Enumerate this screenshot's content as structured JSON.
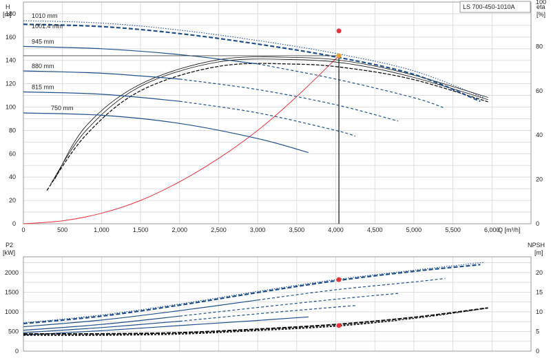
{
  "chart_data": [
    {
      "type": "line",
      "title": "LS 700-450-1010A",
      "x_unit": "Q [m³/h]",
      "xlim": [
        0,
        6500
      ],
      "x_ticks": [
        "0",
        "500",
        "1,000",
        "1,500",
        "2,000",
        "2,500",
        "3,000",
        "3,500",
        "4,000",
        "4,500",
        "5,000",
        "5,500",
        "6,000"
      ],
      "left_axis": {
        "label": "H",
        "unit": "[m]",
        "ylim": [
          0,
          190
        ],
        "ticks": [
          "0",
          "20",
          "40",
          "60",
          "80",
          "100",
          "120",
          "140",
          "160",
          "180"
        ]
      },
      "right_axis": {
        "label": "eta",
        "unit": "[%]",
        "ylim": [
          0,
          100
        ],
        "ticks": [
          "0",
          "20",
          "40",
          "60",
          "80",
          "100"
        ]
      },
      "grid": true,
      "colors": {
        "head": "#1f4e8c",
        "eta": "#111111",
        "system": "#e8323c",
        "duty_eta": "#e8323c",
        "duty_head": "#f0a030"
      },
      "head_curves": [
        {
          "name": "1010 mm",
          "dash": "dotted",
          "points": [
            [
              0,
              174
            ],
            [
              1000,
              172
            ],
            [
              2000,
              166
            ],
            [
              3000,
              157
            ],
            [
              4000,
              146
            ],
            [
              5000,
              131
            ],
            [
              5900,
              108
            ]
          ]
        },
        {
          "name": "1001.4 mm",
          "dash": "dashed-thick",
          "points": [
            [
              0,
              171
            ],
            [
              1000,
              169
            ],
            [
              2000,
              163
            ],
            [
              3000,
              154
            ],
            [
              4000,
              143
            ],
            [
              5000,
              128
            ],
            [
              5850,
              105
            ]
          ]
        },
        {
          "name": "945 mm",
          "dash": "solid-dashed",
          "points": [
            [
              0,
              152
            ],
            [
              1000,
              150
            ],
            [
              2000,
              145
            ],
            [
              3000,
              137
            ],
            [
              4000,
              124
            ],
            [
              5000,
              108
            ],
            [
              5400,
              99
            ]
          ]
        },
        {
          "name": "880 mm",
          "dash": "solid-dashed",
          "points": [
            [
              0,
              131
            ],
            [
              1000,
              129
            ],
            [
              2000,
              124
            ],
            [
              3000,
              115
            ],
            [
              4000,
              102
            ],
            [
              4800,
              88
            ]
          ]
        },
        {
          "name": "815 mm",
          "dash": "solid-dashed",
          "points": [
            [
              0,
              113
            ],
            [
              1000,
              111
            ],
            [
              2000,
              105
            ],
            [
              3000,
              95
            ],
            [
              4000,
              80
            ],
            [
              4250,
              75
            ]
          ]
        },
        {
          "name": "750 mm",
          "dash": "solid",
          "points": [
            [
              0,
              95
            ],
            [
              1000,
              93
            ],
            [
              2000,
              86
            ],
            [
              3000,
              73
            ],
            [
              3650,
              61
            ]
          ]
        }
      ],
      "eta_curves": [
        {
          "points": [
            [
              300,
              15
            ],
            [
              800,
              40
            ],
            [
              1500,
              60
            ],
            [
              2500,
              71
            ],
            [
              3500,
              72
            ],
            [
              4200,
              70
            ],
            [
              5000,
              65
            ],
            [
              5950,
              55
            ]
          ]
        },
        {
          "points": [
            [
              350,
              18
            ],
            [
              800,
              42
            ],
            [
              1500,
              62
            ],
            [
              2500,
              73
            ],
            [
              3500,
              74
            ],
            [
              4200,
              72
            ],
            [
              5000,
              66
            ],
            [
              5950,
              56
            ]
          ]
        },
        {
          "points": [
            [
              400,
              20
            ],
            [
              800,
              44
            ],
            [
              1500,
              63
            ],
            [
              2500,
              74
            ],
            [
              3500,
              75
            ],
            [
              4200,
              73
            ],
            [
              5000,
              67
            ],
            [
              5950,
              57
            ]
          ]
        }
      ],
      "system_curve": [
        [
          0,
          0
        ],
        [
          500,
          2.5
        ],
        [
          1000,
          9
        ],
        [
          1500,
          20
        ],
        [
          2000,
          36
        ],
        [
          2500,
          56
        ],
        [
          3000,
          80
        ],
        [
          3500,
          109
        ],
        [
          4040,
          144
        ]
      ],
      "duty_point": {
        "q": 4040,
        "head": 144,
        "eta": 87
      }
    },
    {
      "type": "line",
      "x_unit": "Q [m³/h]",
      "xlim": [
        0,
        6500
      ],
      "left_axis": {
        "label": "P2",
        "unit": "[kW]",
        "ylim": [
          0,
          2400
        ],
        "ticks": [
          "0",
          "500",
          "1000",
          "1500",
          "2000"
        ]
      },
      "right_axis": {
        "label": "NPSH",
        "unit": "[m]",
        "ylim": [
          0,
          24
        ],
        "ticks": [
          "0",
          "5",
          "10",
          "15",
          "20"
        ]
      },
      "grid": true,
      "colors": {
        "power": "#1f4e8c",
        "npsh": "#111111",
        "duty": "#e8323c"
      },
      "power_curves": [
        {
          "dash": "dotted",
          "points": [
            [
              0,
              720
            ],
            [
              1000,
              920
            ],
            [
              2000,
              1200
            ],
            [
              3000,
              1520
            ],
            [
              4000,
              1820
            ],
            [
              5000,
              2060
            ],
            [
              5900,
              2260
            ]
          ]
        },
        {
          "dash": "dashed-thick",
          "points": [
            [
              0,
              700
            ],
            [
              1000,
              890
            ],
            [
              2000,
              1170
            ],
            [
              3000,
              1490
            ],
            [
              4000,
              1790
            ],
            [
              5000,
              2030
            ],
            [
              5850,
              2200
            ]
          ]
        },
        {
          "dash": "solid-dashed",
          "points": [
            [
              0,
              620
            ],
            [
              1000,
              790
            ],
            [
              2000,
              1030
            ],
            [
              3000,
              1300
            ],
            [
              4000,
              1560
            ],
            [
              5000,
              1760
            ],
            [
              5400,
              1850
            ]
          ]
        },
        {
          "dash": "solid-dashed",
          "points": [
            [
              0,
              530
            ],
            [
              1000,
              680
            ],
            [
              2000,
              890
            ],
            [
              3000,
              1110
            ],
            [
              4000,
              1320
            ],
            [
              4800,
              1470
            ]
          ]
        },
        {
          "dash": "solid-dashed",
          "points": [
            [
              0,
              470
            ],
            [
              1000,
              600
            ],
            [
              2000,
              760
            ],
            [
              3000,
              950
            ],
            [
              4000,
              1120
            ],
            [
              4250,
              1160
            ]
          ]
        },
        {
          "dash": "solid",
          "points": [
            [
              0,
              410
            ],
            [
              1000,
              520
            ],
            [
              2000,
              650
            ],
            [
              3000,
              780
            ],
            [
              3650,
              870
            ]
          ]
        }
      ],
      "npsh_curves": [
        {
          "points": [
            [
              0,
              4.4
            ],
            [
              1000,
              4.4
            ],
            [
              2000,
              4.7
            ],
            [
              3000,
              5.6
            ],
            [
              4000,
              6.8
            ],
            [
              5000,
              8.6
            ],
            [
              5950,
              11.0
            ]
          ]
        },
        {
          "points": [
            [
              0,
              4.2
            ],
            [
              1000,
              4.2
            ],
            [
              2000,
              4.5
            ],
            [
              3000,
              5.4
            ],
            [
              4000,
              6.5
            ],
            [
              5000,
              8.3
            ],
            [
              5900,
              10.8
            ]
          ]
        },
        {
          "points": [
            [
              0,
              4.0
            ],
            [
              1000,
              4.0
            ],
            [
              2000,
              4.3
            ],
            [
              3000,
              5.2
            ],
            [
              4000,
              6.3
            ],
            [
              4800,
              7.8
            ]
          ]
        }
      ],
      "duty_point": {
        "q": 4040,
        "power": 1820,
        "npsh": 6.5
      }
    }
  ]
}
